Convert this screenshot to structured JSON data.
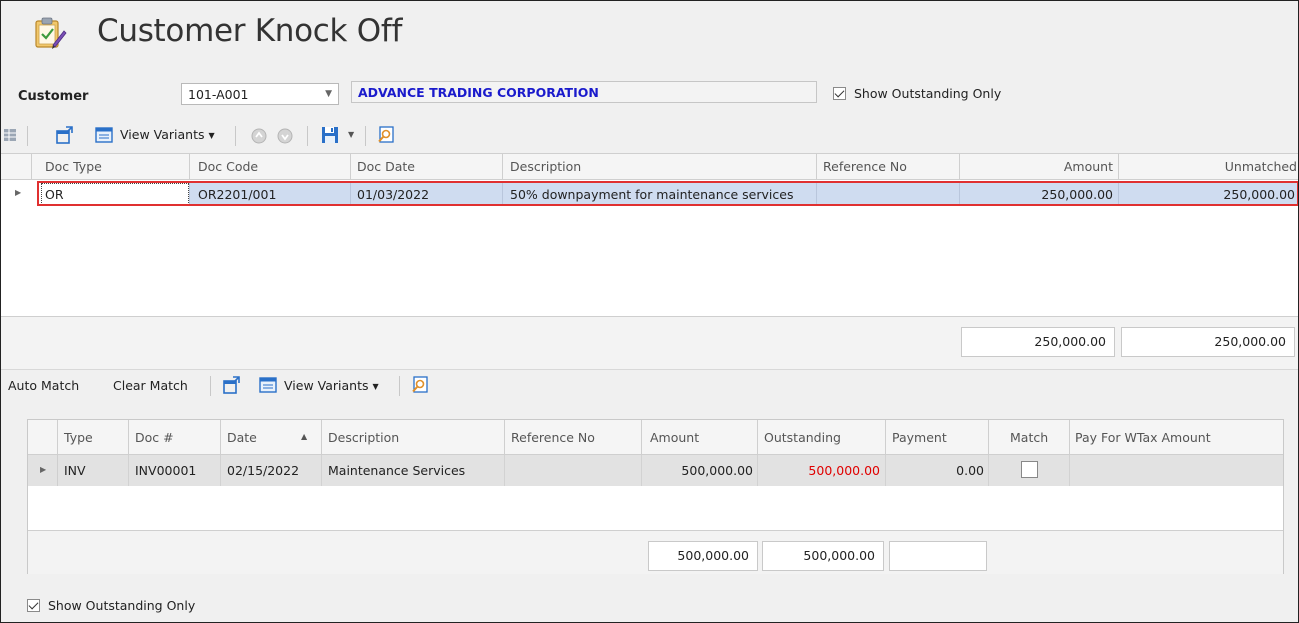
{
  "window": {
    "title": "Customer Knock Off"
  },
  "customer": {
    "label": "Customer",
    "code": "101-A001",
    "name": "ADVANCE TRADING CORPORATION",
    "show_outstanding_label": "Show Outstanding Only",
    "show_outstanding_checked": true
  },
  "toolbar1": {
    "view_variants": "View Variants",
    "icons": [
      "grid-icon",
      "new-window-icon",
      "view-variants-icon",
      "up-circle-icon",
      "down-circle-icon",
      "save-icon",
      "dropdown-arrow-icon",
      "find-icon"
    ]
  },
  "grid1": {
    "columns": [
      "Doc Type",
      "Doc Code",
      "Doc Date",
      "Description",
      "Reference No",
      "Amount",
      "Unmatched"
    ],
    "rows": [
      {
        "doc_type": "OR",
        "doc_code": "OR2201/001",
        "doc_date": "01/03/2022",
        "description": "50% downpayment for maintenance services",
        "reference_no": "",
        "amount": "250,000.00",
        "unmatched": "250,000.00"
      }
    ],
    "totals": {
      "amount": "250,000.00",
      "unmatched": "250,000.00"
    },
    "highlight_color": "#e03030",
    "selected_row_color": "#cfdcf0"
  },
  "toolbar2": {
    "auto_match": "Auto Match",
    "clear_match": "Clear Match",
    "view_variants": "View Variants"
  },
  "grid2": {
    "columns": [
      "Type",
      "Doc #",
      "Date",
      "Description",
      "Reference No",
      "Amount",
      "Outstanding",
      "Payment",
      "Match",
      "Pay For WTax Amount"
    ],
    "rows": [
      {
        "type": "INV",
        "doc_no": "INV00001",
        "date": "02/15/2022",
        "description": "Maintenance Services",
        "reference_no": "",
        "amount": "500,000.00",
        "outstanding": "500,000.00",
        "payment": "0.00",
        "match": false,
        "pay_for_wtax": ""
      }
    ],
    "totals": {
      "amount": "500,000.00",
      "outstanding": "500,000.00",
      "payment": ""
    },
    "outstanding_color": "#e00000"
  },
  "footer": {
    "show_outstanding_label": "Show Outstanding Only",
    "show_outstanding_checked": true
  }
}
